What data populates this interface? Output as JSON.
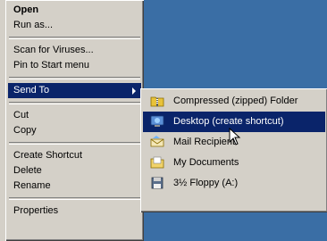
{
  "context_menu": {
    "items": [
      {
        "label": "Open"
      },
      {
        "label": "Run as..."
      },
      {
        "label": "Scan for Viruses..."
      },
      {
        "label": "Pin to Start menu"
      },
      {
        "label": "Send To"
      },
      {
        "label": "Cut"
      },
      {
        "label": "Copy"
      },
      {
        "label": "Create Shortcut"
      },
      {
        "label": "Delete"
      },
      {
        "label": "Rename"
      },
      {
        "label": "Properties"
      }
    ]
  },
  "sendto_menu": {
    "items": [
      {
        "label": "Compressed (zipped) Folder",
        "icon": "zip-folder-icon"
      },
      {
        "label": "Desktop (create shortcut)",
        "icon": "desktop-icon"
      },
      {
        "label": "Mail Recipient",
        "icon": "mail-icon"
      },
      {
        "label": "My Documents",
        "icon": "my-documents-icon"
      },
      {
        "label": "3½ Floppy (A:)",
        "icon": "floppy-icon"
      }
    ]
  },
  "colors": {
    "desktop": "#3a6ea5",
    "menu": "#d4d0c8",
    "highlight": "#0a246a"
  }
}
